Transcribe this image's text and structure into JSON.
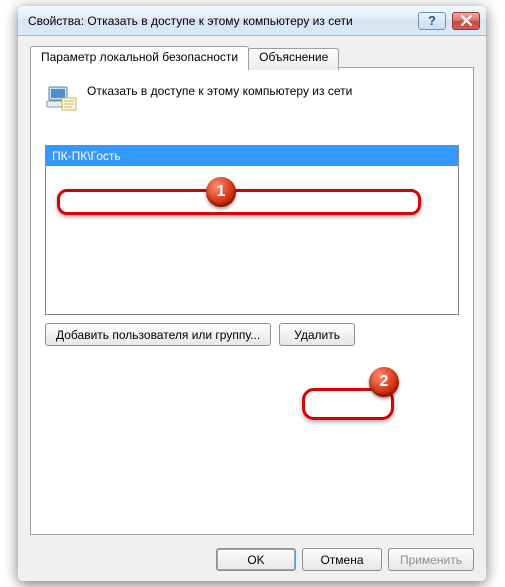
{
  "window": {
    "title": "Свойства: Отказать в доступе к этому компьютеру из сети",
    "help_symbol": "?",
    "close_label": "close"
  },
  "tabs": {
    "active_label": "Параметр локальной безопасности",
    "inactive_label": "Объяснение"
  },
  "policy": {
    "title": "Отказать в доступе к этому компьютеру из сети"
  },
  "list": {
    "items": [
      {
        "label": "ПК-ПК\\Гость",
        "selected": true
      }
    ]
  },
  "buttons": {
    "add": "Добавить пользователя или группу...",
    "remove": "Удалить",
    "ok": "OK",
    "cancel": "Отмена",
    "apply": "Применить"
  },
  "callouts": {
    "badge1": "1",
    "badge2": "2"
  },
  "colors": {
    "selection": "#3399ff",
    "callout": "#d80000"
  }
}
